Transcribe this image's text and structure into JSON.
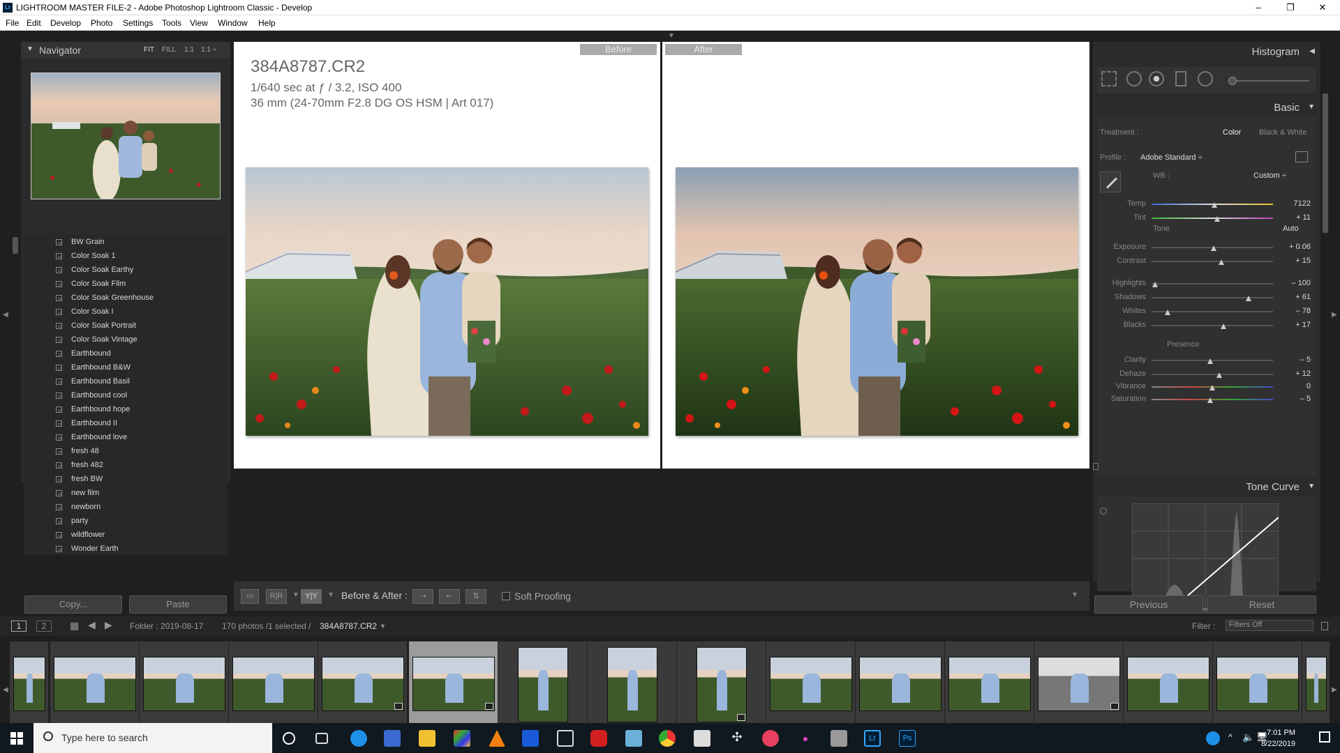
{
  "window": {
    "title": "LIGHTROOM MASTER FILE-2 - Adobe Photoshop Lightroom Classic - Develop",
    "app_icon": "Lr",
    "minimize": "–",
    "maximize": "❐",
    "close": "✕"
  },
  "menu": [
    "File",
    "Edit",
    "Develop",
    "Photo",
    "Settings",
    "Tools",
    "View",
    "Window",
    "Help"
  ],
  "navigator": {
    "title": "Navigator",
    "zoom": [
      "FIT",
      "FILL",
      "1:1",
      "1:1 ÷"
    ]
  },
  "presets": [
    "BW Grain",
    "Color Soak 1",
    "Color Soak Earthy",
    "Color Soak Film",
    "Color Soak Greenhouse",
    "Color Soak I",
    "Color Soak Portrait",
    "Color Soak Vintage",
    "Earthbound",
    "Earthbound B&W",
    "Earthbound Basil",
    "Earthbound cool",
    "Earthbound hope",
    "Earthbound II",
    "Earthbound love",
    "fresh 48",
    "fresh 482",
    "fresh BW",
    "new film",
    "newborn",
    "party",
    "wildflower",
    "Wonder Earth"
  ],
  "left_buttons": {
    "copy": "Copy...",
    "paste": "Paste"
  },
  "view": {
    "before_label": "Before",
    "after_label": "After",
    "filename": "384A8787.CR2",
    "exposure_info": "1/640 sec at ƒ / 3.2, ISO 400",
    "lens_info": "36 mm (24-70mm F2.8 DG OS HSM | Art 017)"
  },
  "toolbar": {
    "before_after_label": "Before & After :",
    "soft_proofing": "Soft Proofing",
    "rarr": "R|R",
    "yy": "Y|Y"
  },
  "right": {
    "histogram": "Histogram",
    "basic": "Basic",
    "treatment_label": "Treatment :",
    "treatment_color": "Color",
    "treatment_bw": "Black & White",
    "profile_label": "Profile :",
    "profile_value": "Adobe Standard ÷",
    "wb_label": "WB :",
    "wb_value": "Custom ÷",
    "tone_label": "Tone",
    "auto": "Auto",
    "presence_label": "Presence",
    "tone_curve": "Tone Curve",
    "previous": "Previous",
    "reset": "Reset",
    "sliders": {
      "temp": {
        "label": "Temp",
        "value": "7122",
        "pos": 0.52
      },
      "tint": {
        "label": "Tint",
        "value": "+ 11",
        "pos": 0.54
      },
      "exposure": {
        "label": "Exposure",
        "value": "+ 0.06",
        "pos": 0.51
      },
      "contrast": {
        "label": "Contrast",
        "value": "+ 15",
        "pos": 0.575
      },
      "highlights": {
        "label": "Highlights",
        "value": "– 100",
        "pos": 0.03
      },
      "shadows": {
        "label": "Shadows",
        "value": "+ 61",
        "pos": 0.8
      },
      "whites": {
        "label": "Whites",
        "value": "– 78",
        "pos": 0.13
      },
      "blacks": {
        "label": "Blacks",
        "value": "+ 17",
        "pos": 0.59
      },
      "clarity": {
        "label": "Clarity",
        "value": "– 5",
        "pos": 0.48
      },
      "dehaze": {
        "label": "Dehaze",
        "value": "+ 12",
        "pos": 0.56
      },
      "vibrance": {
        "label": "Vibrance",
        "value": "0",
        "pos": 0.5
      },
      "saturation": {
        "label": "Saturation",
        "value": "– 5",
        "pos": 0.48
      }
    }
  },
  "filmstrip": {
    "page1": "1",
    "page2": "2",
    "folder": "Folder : 2019-08-17",
    "count": "170 photos /1 selected /",
    "selected_file": "384A8787.CR2",
    "filter_label": "Filter :",
    "filter_value": "Filters Off"
  },
  "taskbar": {
    "search_placeholder": "Type here to search",
    "time": "7:01 PM",
    "date": "8/22/2019"
  }
}
